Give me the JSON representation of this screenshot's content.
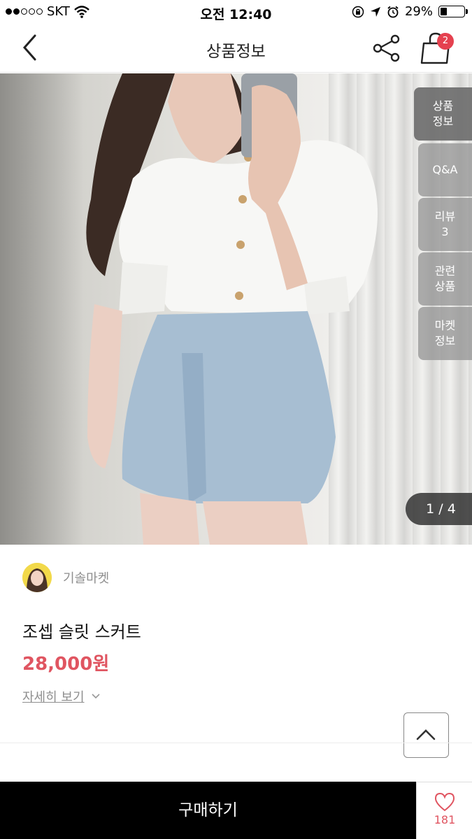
{
  "status_bar": {
    "carrier": "SKT",
    "time": "오전 12:40",
    "battery": "29%",
    "battery_level": 0.29
  },
  "nav": {
    "title": "상품정보",
    "cart_count": "2"
  },
  "gallery": {
    "tabs": [
      {
        "label": "상품\n정보",
        "active": true
      },
      {
        "label": "Q&A",
        "active": false
      },
      {
        "label": "리뷰\n3",
        "active": false
      },
      {
        "label": "관련\n상품",
        "active": false
      },
      {
        "label": "마켓\n정보",
        "active": false
      }
    ],
    "page_indicator": "1 / 4"
  },
  "product": {
    "seller_name": "기솔마켓",
    "title": "조셉 슬릿 스커트",
    "price": "28,000원",
    "detail_link": "자세히 보기"
  },
  "bottom_bar": {
    "buy_label": "구매하기",
    "like_count": "181"
  },
  "colors": {
    "accent": "#e05561",
    "badge": "#e5414f",
    "buy_bar": "#000000"
  }
}
